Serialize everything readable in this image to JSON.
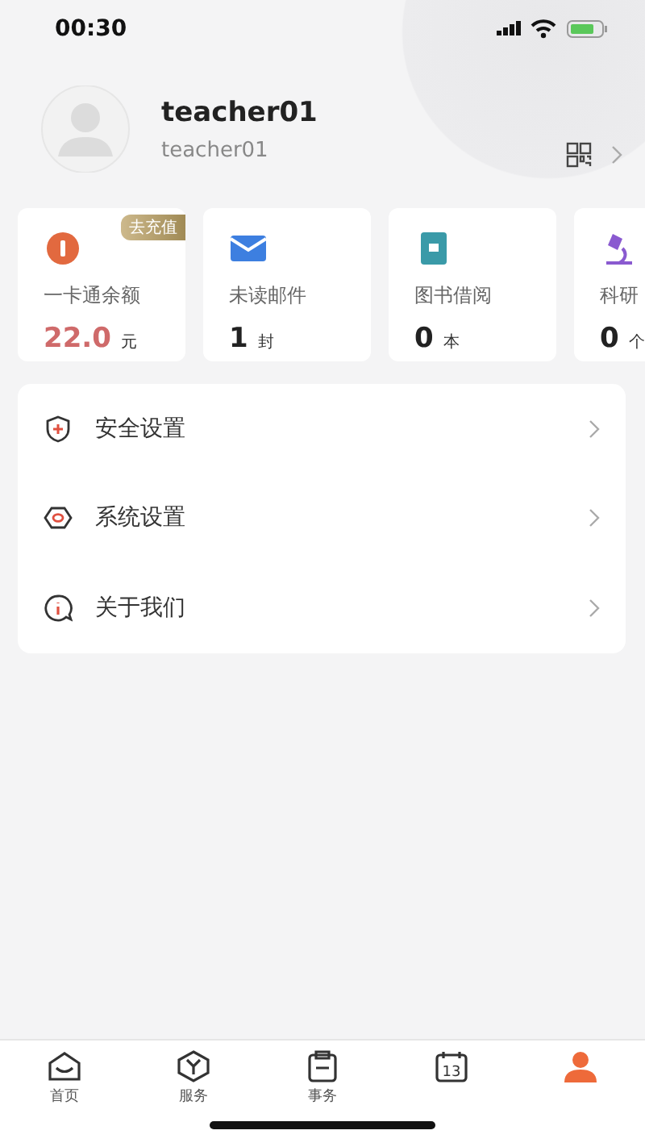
{
  "status_bar": {
    "time": "00:30"
  },
  "profile": {
    "name": "teacher01",
    "account": "teacher01"
  },
  "cards": [
    {
      "kind": "wallet",
      "label": "一卡通余额",
      "value": "22.0",
      "unit": "元",
      "badge": "去充值",
      "color": "#cf6a6a"
    },
    {
      "kind": "mail",
      "label": "未读邮件",
      "value": "1",
      "unit": "封",
      "color": "#222222"
    },
    {
      "kind": "book",
      "label": "图书借阅",
      "value": "0",
      "unit": "本",
      "color": "#222222"
    },
    {
      "kind": "research",
      "label": "科研",
      "value": "0",
      "unit": "个",
      "color": "#222222"
    }
  ],
  "menu": [
    {
      "kind": "security",
      "label": "安全设置"
    },
    {
      "kind": "system",
      "label": "系统设置"
    },
    {
      "kind": "about",
      "label": "关于我们"
    }
  ],
  "tabs": [
    {
      "kind": "home",
      "label": "首页",
      "selected": false
    },
    {
      "kind": "service",
      "label": "服务",
      "selected": false
    },
    {
      "kind": "affairs",
      "label": "事务",
      "selected": false
    },
    {
      "kind": "calendar",
      "icon_text": "13",
      "selected": false
    },
    {
      "kind": "me",
      "selected": true
    }
  ]
}
